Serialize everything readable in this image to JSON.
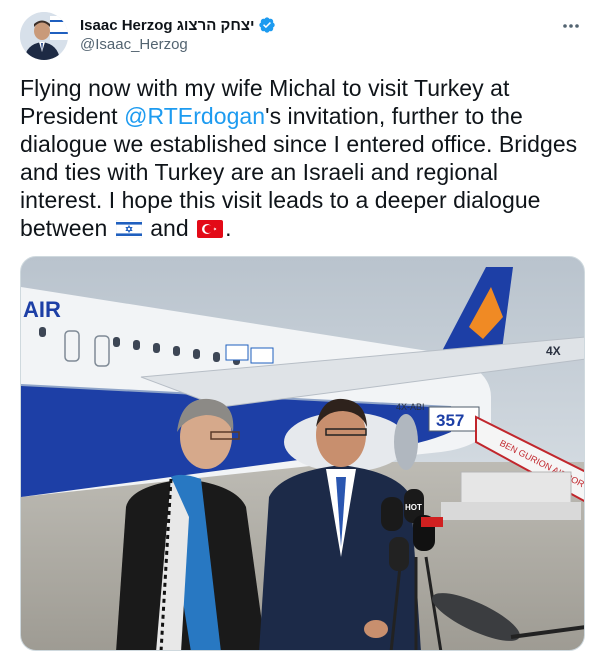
{
  "author": {
    "display_name": "Isaac Herzog יצחק הרצוג",
    "handle": "@Isaac_Herzog",
    "verified": true,
    "avatar_icon": "avatar-photo"
  },
  "tweet": {
    "text_part1": "Flying now with my wife Michal to visit Turkey at President ",
    "mention": "@RTErdogan",
    "text_part2": "'s invitation, further to the dialogue we established since I entered office. Bridges and ties with Turkey are an Israeli and regional interest. I hope this visit leads to a deeper dialogue between ",
    "text_and": " and ",
    "text_end": ".",
    "flags": [
      "israel-flag",
      "turkey-flag"
    ]
  },
  "media": {
    "plane_logo": "AIR",
    "plane_reg": "4X-ABI",
    "gate_number": "357",
    "stairs_text": "BEN GURION AIRPORT",
    "mic_label": "HOT"
  },
  "colors": {
    "accent": "#1d9bf0",
    "text": "#0f1419",
    "secondary": "#536471",
    "border": "#cfd9de"
  }
}
